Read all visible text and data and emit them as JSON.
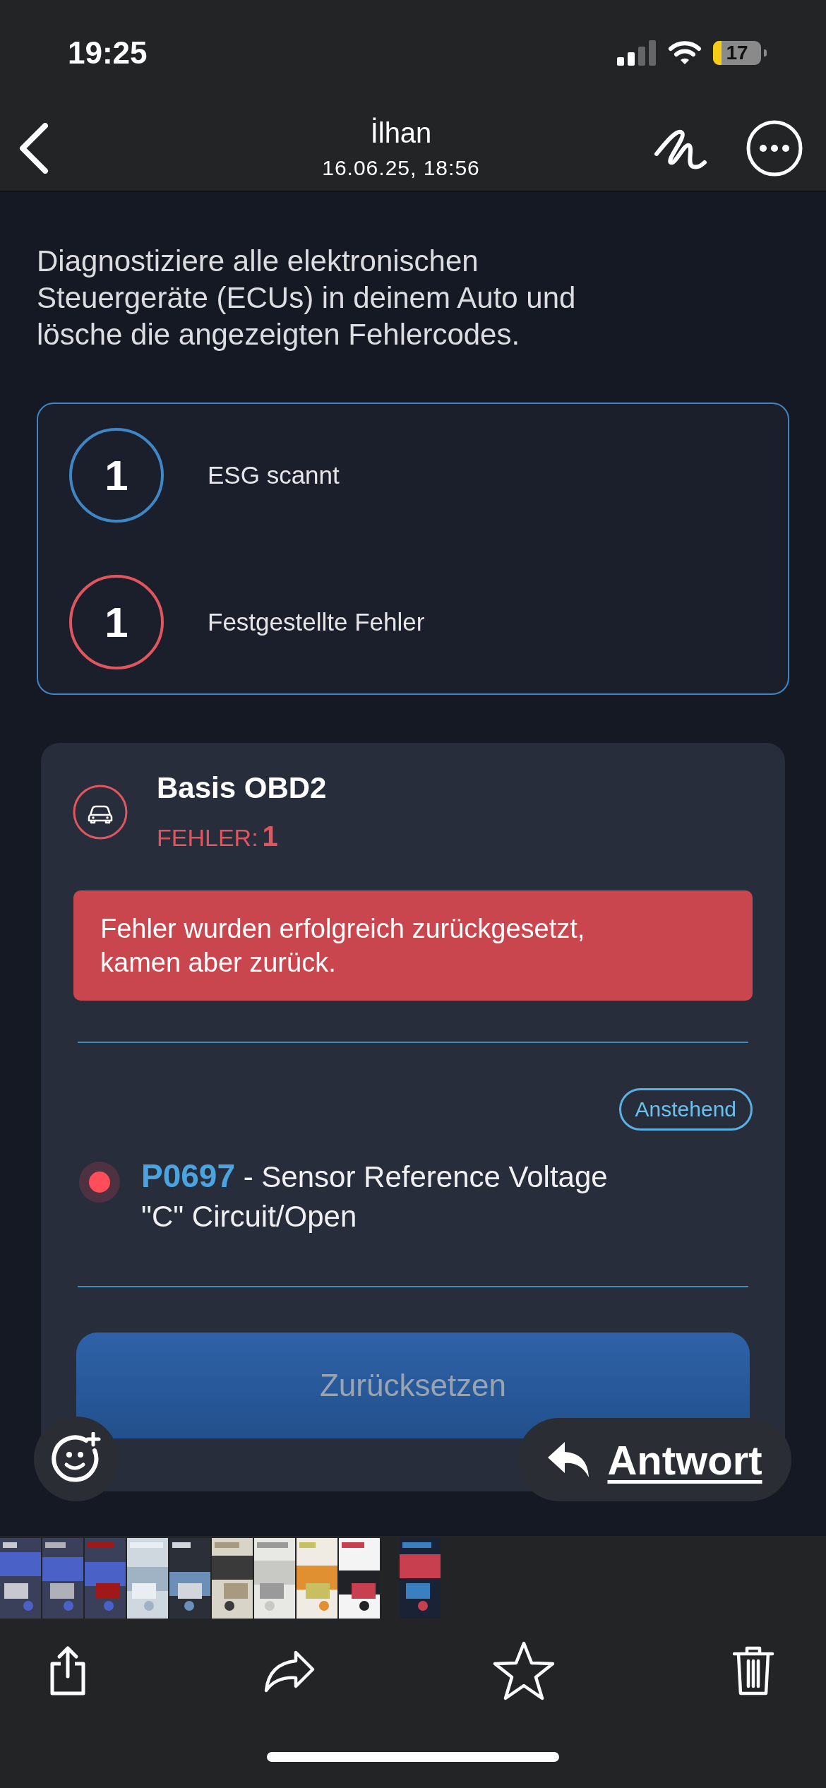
{
  "status_bar": {
    "time": "19:25",
    "battery": "17"
  },
  "header": {
    "title": "İlhan",
    "subtitle": "16.06.25, 18:56"
  },
  "screenshot": {
    "description": "Diagnostiziere alle elektronischen Steuergeräte (ECUs) in deinem Auto und lösche die angezeigten Fehlercodes.",
    "stats": [
      {
        "value": "1",
        "label": "ESG scannt",
        "color": "#3f86c6"
      },
      {
        "value": "1",
        "label": "Festgestellte Fehler",
        "color": "#e0565e"
      }
    ],
    "module": {
      "title": "Basis OBD2",
      "error_label": "FEHLER:",
      "error_count": "1",
      "alert": "Fehler wurden erfolgreich zurückgesetzt, kamen aber zurück.",
      "badge": "Anstehend",
      "fault_code": "P0697",
      "fault_text": " - Sensor Reference Voltage \"C\" Circuit/Open",
      "button": "Zurücksetzen"
    }
  },
  "reply_button": "Antwort"
}
